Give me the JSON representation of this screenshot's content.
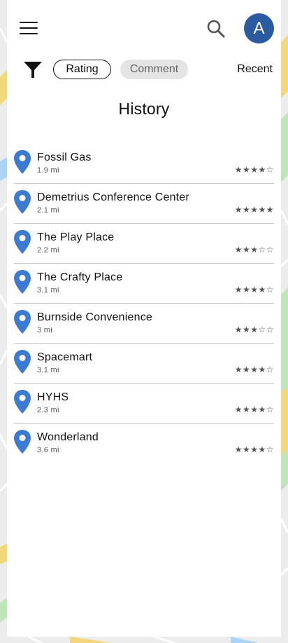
{
  "colors": {
    "accent": "#2a5aa0",
    "pin": "#3b7bd6",
    "map_water": "#a9d4f5",
    "map_park": "#bfe6b9",
    "map_road": "#f3d77a"
  },
  "header": {
    "menu_icon": "hamburger-menu-icon",
    "search_icon": "search-icon",
    "avatar_initial": "A"
  },
  "filters": {
    "filter_icon": "filter-funnel-icon",
    "chips": [
      {
        "label": "Rating",
        "selected": true
      },
      {
        "label": "Comment",
        "selected": false
      }
    ],
    "sort_label": "Recent"
  },
  "page": {
    "title": "History"
  },
  "history": [
    {
      "name": "Fossil Gas",
      "distance": "1.9 mi",
      "rating": 4,
      "stars": "★★★★☆"
    },
    {
      "name": "Demetrius Conference Center",
      "distance": "2.1 mi",
      "rating": 5,
      "stars": "★★★★★"
    },
    {
      "name": "The Play Place",
      "distance": "2.2 mi",
      "rating": 3,
      "stars": "★★★☆☆"
    },
    {
      "name": "The Crafty Place",
      "distance": "3.1 mi",
      "rating": 4,
      "stars": "★★★★☆"
    },
    {
      "name": "Burnside Convenience",
      "distance": "3 mi",
      "rating": 3,
      "stars": "★★★☆☆"
    },
    {
      "name": "Spacemart",
      "distance": "3.1 mi",
      "rating": 4,
      "stars": "★★★★☆"
    },
    {
      "name": "HYHS",
      "distance": "2.3 mi",
      "rating": 4,
      "stars": "★★★★☆"
    },
    {
      "name": "Wonderland",
      "distance": "3.6 mi",
      "rating": 4,
      "stars": "★★★★☆"
    }
  ]
}
